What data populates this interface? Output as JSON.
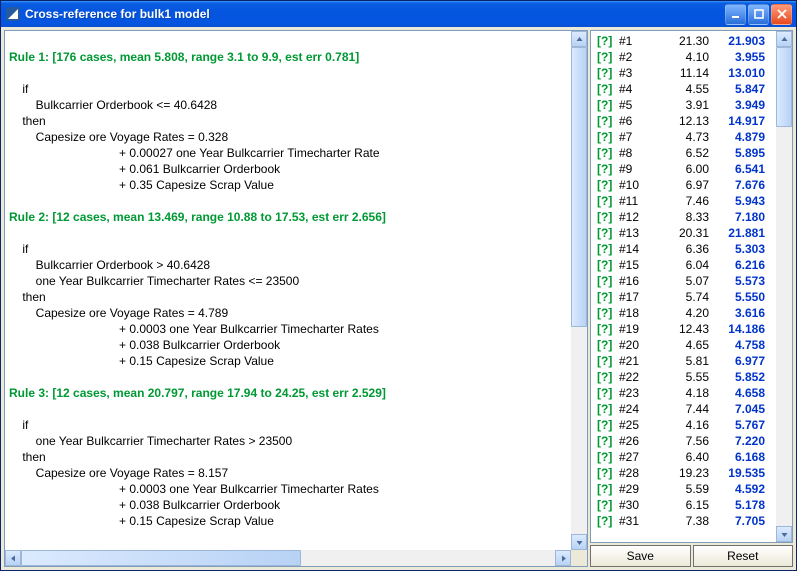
{
  "window": {
    "title": "Cross-reference for bulk1 model"
  },
  "rules": [
    {
      "header": "Rule 1: [176 cases, mean 5.808, range 3.1 to 9.9, est err 0.781]",
      "if_lines": [
        "Bulkcarrier Orderbook <= 40.6428"
      ],
      "target": "Capesize ore Voyage Rates",
      "intercept": "0.328",
      "terms": [
        "+ 0.00027 one Year Bulkcarrier Timecharter Rate",
        "+ 0.061 Bulkcarrier Orderbook",
        "+ 0.35 Capesize Scrap Value"
      ]
    },
    {
      "header": "Rule 2: [12 cases, mean 13.469, range 10.88 to 17.53, est err 2.656]",
      "if_lines": [
        "Bulkcarrier Orderbook > 40.6428",
        "one Year Bulkcarrier Timecharter Rates <= 23500"
      ],
      "target": "Capesize ore Voyage Rates",
      "intercept": "4.789",
      "terms": [
        "+ 0.0003 one Year Bulkcarrier Timecharter Rates",
        "+ 0.038 Bulkcarrier Orderbook",
        "+ 0.15 Capesize Scrap Value"
      ]
    },
    {
      "header": "Rule 3: [12 cases, mean 20.797, range 17.94 to 24.25, est err 2.529]",
      "if_lines": [
        "one Year Bulkcarrier Timecharter Rates > 23500"
      ],
      "target": "Capesize ore Voyage Rates",
      "intercept": "8.157",
      "terms": [
        "+ 0.0003 one Year Bulkcarrier Timecharter Rates",
        "+ 0.038 Bulkcarrier Orderbook",
        "+ 0.15 Capesize Scrap Value"
      ]
    }
  ],
  "kw_if": "if",
  "kw_then": "then",
  "kw_eq": "=",
  "qmark": "[?]",
  "cases": [
    {
      "id": "#1",
      "v1": "21.30",
      "v2": "21.903"
    },
    {
      "id": "#2",
      "v1": "4.10",
      "v2": "3.955"
    },
    {
      "id": "#3",
      "v1": "11.14",
      "v2": "13.010"
    },
    {
      "id": "#4",
      "v1": "4.55",
      "v2": "5.847"
    },
    {
      "id": "#5",
      "v1": "3.91",
      "v2": "3.949"
    },
    {
      "id": "#6",
      "v1": "12.13",
      "v2": "14.917"
    },
    {
      "id": "#7",
      "v1": "4.73",
      "v2": "4.879"
    },
    {
      "id": "#8",
      "v1": "6.52",
      "v2": "5.895"
    },
    {
      "id": "#9",
      "v1": "6.00",
      "v2": "6.541"
    },
    {
      "id": "#10",
      "v1": "6.97",
      "v2": "7.676"
    },
    {
      "id": "#11",
      "v1": "7.46",
      "v2": "5.943"
    },
    {
      "id": "#12",
      "v1": "8.33",
      "v2": "7.180"
    },
    {
      "id": "#13",
      "v1": "20.31",
      "v2": "21.881"
    },
    {
      "id": "#14",
      "v1": "6.36",
      "v2": "5.303"
    },
    {
      "id": "#15",
      "v1": "6.04",
      "v2": "6.216"
    },
    {
      "id": "#16",
      "v1": "5.07",
      "v2": "5.573"
    },
    {
      "id": "#17",
      "v1": "5.74",
      "v2": "5.550"
    },
    {
      "id": "#18",
      "v1": "4.20",
      "v2": "3.616"
    },
    {
      "id": "#19",
      "v1": "12.43",
      "v2": "14.186"
    },
    {
      "id": "#20",
      "v1": "4.65",
      "v2": "4.758"
    },
    {
      "id": "#21",
      "v1": "5.81",
      "v2": "6.977"
    },
    {
      "id": "#22",
      "v1": "5.55",
      "v2": "5.852"
    },
    {
      "id": "#23",
      "v1": "4.18",
      "v2": "4.658"
    },
    {
      "id": "#24",
      "v1": "7.44",
      "v2": "7.045"
    },
    {
      "id": "#25",
      "v1": "4.16",
      "v2": "5.767"
    },
    {
      "id": "#26",
      "v1": "7.56",
      "v2": "7.220"
    },
    {
      "id": "#27",
      "v1": "6.40",
      "v2": "6.168"
    },
    {
      "id": "#28",
      "v1": "19.23",
      "v2": "19.535"
    },
    {
      "id": "#29",
      "v1": "5.59",
      "v2": "4.592"
    },
    {
      "id": "#30",
      "v1": "6.15",
      "v2": "5.178"
    },
    {
      "id": "#31",
      "v1": "7.38",
      "v2": "7.705"
    }
  ],
  "buttons": {
    "save": "Save",
    "reset": "Reset"
  }
}
